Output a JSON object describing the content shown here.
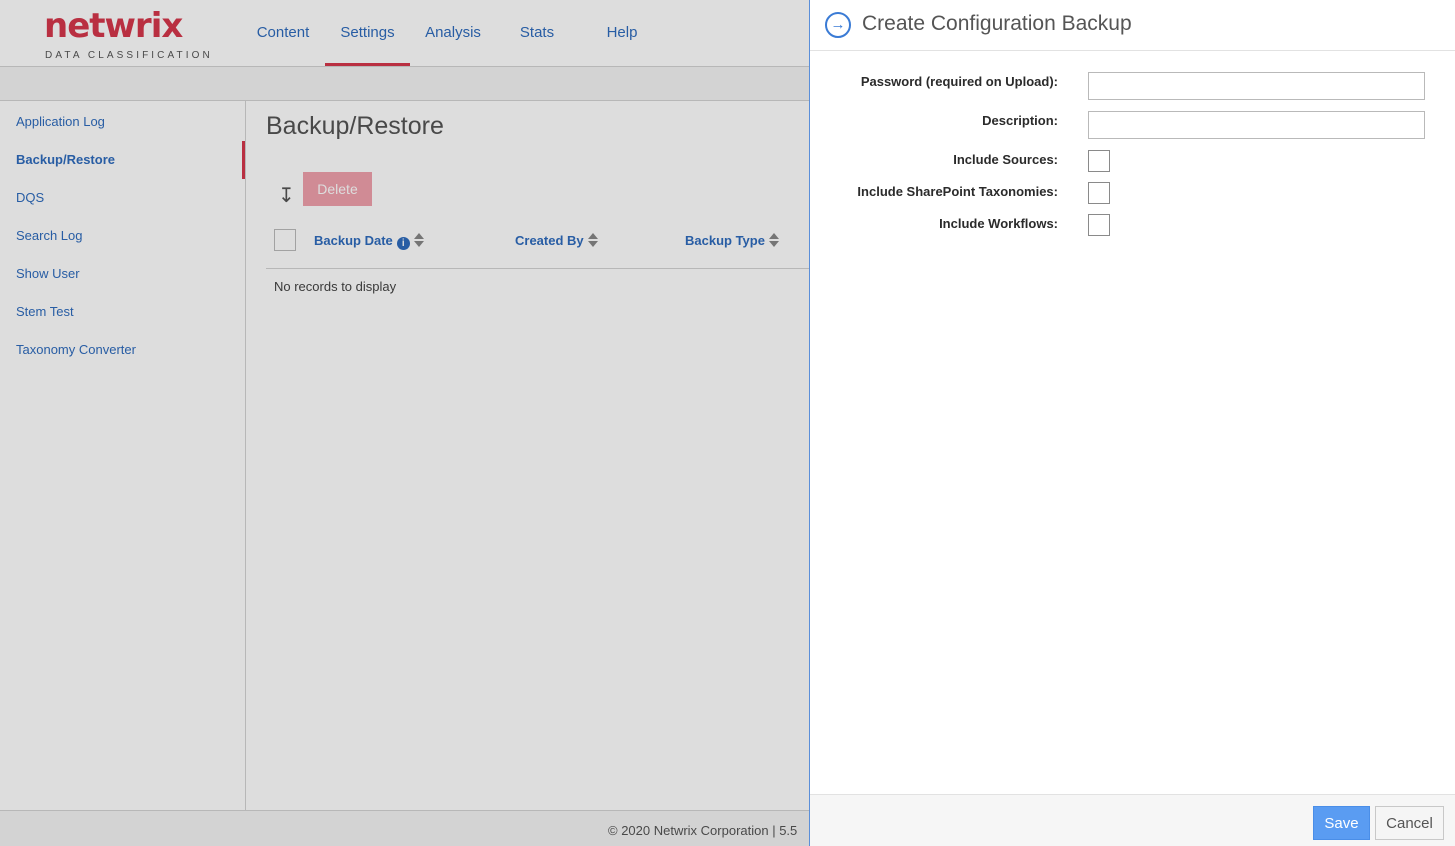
{
  "brand": {
    "logo_text": "netwrix",
    "logo_subtitle": "DATA CLASSIFICATION",
    "accent_color": "#d6374b",
    "link_color": "#2f6cbe"
  },
  "nav": {
    "items": [
      {
        "label": "Content",
        "active": false
      },
      {
        "label": "Settings",
        "active": true
      },
      {
        "label": "Analysis",
        "active": false
      },
      {
        "label": "Stats",
        "active": false
      },
      {
        "label": "Help",
        "active": false
      }
    ]
  },
  "sidebar": {
    "items": [
      {
        "label": "Application Log",
        "active": false
      },
      {
        "label": "Backup/Restore",
        "active": true
      },
      {
        "label": "DQS",
        "active": false
      },
      {
        "label": "Search Log",
        "active": false
      },
      {
        "label": "Show User",
        "active": false
      },
      {
        "label": "Stem Test",
        "active": false
      },
      {
        "label": "Taxonomy Converter",
        "active": false
      }
    ]
  },
  "main": {
    "title": "Backup/Restore",
    "toolbar": {
      "download_icon": "arrow-down-icon",
      "delete_label": "Delete"
    },
    "grid": {
      "columns": [
        {
          "label": "Backup Date",
          "has_info": true
        },
        {
          "label": "Created By",
          "has_info": false
        },
        {
          "label": "Backup Type",
          "has_info": false
        }
      ],
      "info_icon": "i",
      "empty_text": "No records to display"
    }
  },
  "footer": {
    "copyright": "© 2020 Netwrix Corporation | 5.5"
  },
  "panel": {
    "title": "Create Configuration Backup",
    "header_icon": "arrow-right-circle-icon",
    "fields": {
      "password": {
        "label": "Password (required on Upload):",
        "value": ""
      },
      "description": {
        "label": "Description:",
        "value": ""
      },
      "include_sources": {
        "label": "Include Sources:",
        "checked": false
      },
      "include_taxonomies": {
        "label": "Include SharePoint Taxonomies:",
        "checked": false
      },
      "include_workflows": {
        "label": "Include Workflows:",
        "checked": false
      }
    },
    "save_label": "Save",
    "cancel_label": "Cancel",
    "save_color": "#5a9cf2"
  }
}
